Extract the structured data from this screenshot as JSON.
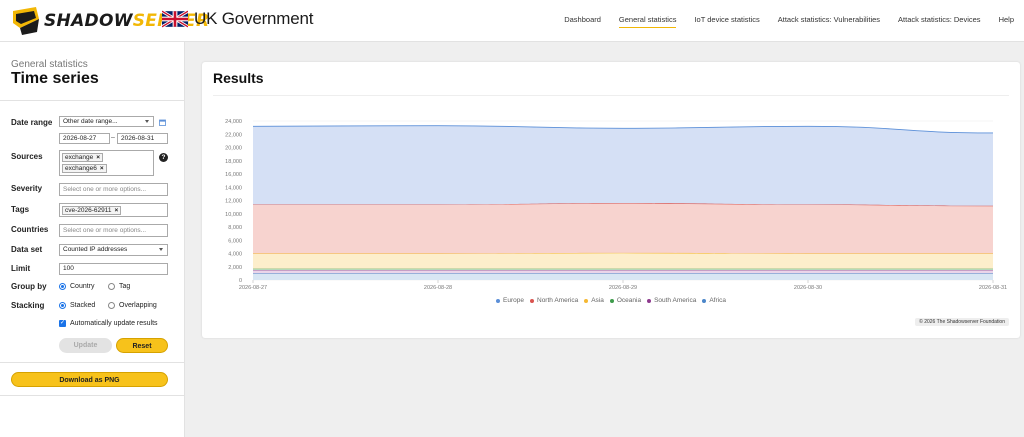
{
  "brand": {
    "logo_name": "SHADOW",
    "logo_accent": "SERVER",
    "partner": "UK Government"
  },
  "nav": [
    {
      "label": "Dashboard",
      "active": false
    },
    {
      "label": "General statistics",
      "active": true
    },
    {
      "label": "IoT device statistics",
      "active": false
    },
    {
      "label": "Attack statistics: Vulnerabilities",
      "active": false
    },
    {
      "label": "Attack statistics: Devices",
      "active": false
    },
    {
      "label": "Help",
      "active": false
    }
  ],
  "sidebar": {
    "subtitle": "General statistics",
    "title": "Time series",
    "date_range": {
      "label": "Date range",
      "mode": "Other date range...",
      "from": "2026-08-27",
      "sep": "–",
      "to": "2026-08-31"
    },
    "sources": {
      "label": "Sources",
      "chips": [
        "exchange",
        "exchange6"
      ]
    },
    "severity": {
      "label": "Severity",
      "placeholder": "Select one or more options..."
    },
    "tags": {
      "label": "Tags",
      "chips": [
        "cve-2026-62911"
      ]
    },
    "countries": {
      "label": "Countries",
      "placeholder": "Select one or more options..."
    },
    "data_set": {
      "label": "Data set",
      "value": "Counted IP addresses"
    },
    "limit": {
      "label": "Limit",
      "value": "100"
    },
    "group_by": {
      "label": "Group by",
      "options": [
        "Country",
        "Tag"
      ],
      "selected": 0
    },
    "stacking": {
      "label": "Stacking",
      "options": [
        "Stacked",
        "Overlapping"
      ],
      "selected": 0
    },
    "auto_update": {
      "label": "Automatically update results",
      "checked": true
    },
    "update_label": "Update",
    "reset_label": "Reset",
    "download_label": "Download as PNG"
  },
  "results": {
    "title": "Results",
    "credit": "© 2026 The Shadowserver Foundation"
  },
  "chart_data": {
    "type": "area",
    "stacked": true,
    "x": [
      "2026-08-27",
      "2026-08-28",
      "2026-08-29",
      "2026-08-30",
      "2026-08-31"
    ],
    "ylim": [
      0,
      24000
    ],
    "yticks": [
      0,
      2000,
      4000,
      6000,
      8000,
      10000,
      12000,
      14000,
      16000,
      18000,
      20000,
      22000,
      24000
    ],
    "ytick_labels": [
      "0",
      "2,000",
      "4,000",
      "6,000",
      "8,000",
      "10,000",
      "12,000",
      "14,000",
      "16,000",
      "18,000",
      "20,000",
      "22,000",
      "24,000"
    ],
    "legend_position": "bottom",
    "series": [
      {
        "name": "Europe",
        "color": "#5b8fd8",
        "fill": "#d5e0f5",
        "values": [
          11800,
          11900,
          11300,
          11800,
          11000
        ]
      },
      {
        "name": "North America",
        "color": "#d9544f",
        "fill": "#f7d3cf",
        "values": [
          7400,
          7400,
          7500,
          7400,
          7200
        ]
      },
      {
        "name": "Asia",
        "color": "#f5b833",
        "fill": "#fdeecb",
        "values": [
          2300,
          2300,
          2400,
          2300,
          2300
        ]
      },
      {
        "name": "Oceania",
        "color": "#3e9b4b",
        "fill": "#dcefdc",
        "values": [
          200,
          200,
          200,
          200,
          200
        ]
      },
      {
        "name": "South America",
        "color": "#8e3a8e",
        "fill": "#ead5ea",
        "values": [
          500,
          500,
          500,
          500,
          500
        ]
      },
      {
        "name": "Africa",
        "color": "#4b86c9",
        "fill": "#d8e6f4",
        "values": [
          1000,
          1000,
          1000,
          1000,
          1000
        ]
      }
    ]
  }
}
